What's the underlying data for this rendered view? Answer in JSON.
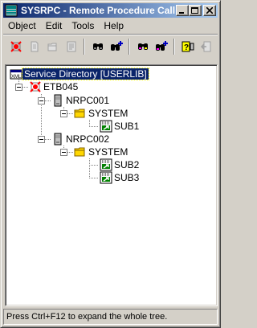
{
  "window": {
    "title": "SYSRPC - Remote Procedure Call"
  },
  "menu": {
    "items": [
      "Object",
      "Edit",
      "Tools",
      "Help"
    ]
  },
  "toolbar": {
    "buttons": [
      {
        "icon": "connect-icon"
      },
      {
        "icon": "new-document-icon"
      },
      {
        "icon": "folder-icon"
      },
      {
        "icon": "properties-icon"
      },
      {
        "icon": "find-icon"
      },
      {
        "icon": "find-next-icon"
      },
      {
        "icon": "find-colored-icon"
      },
      {
        "icon": "find-colored-next-icon"
      },
      {
        "icon": "help-icon"
      },
      {
        "icon": "exit-icon"
      }
    ]
  },
  "tree": {
    "root": "Service Directory [USERLIB]",
    "host": "ETB045",
    "nodes": [
      {
        "name": "NRPC001",
        "library": "SYSTEM",
        "subprograms": [
          "SUB1"
        ]
      },
      {
        "name": "NRPC002",
        "library": "SYSTEM",
        "subprograms": [
          "SUB2",
          "SUB3"
        ]
      }
    ]
  },
  "status": {
    "text": "Press Ctrl+F12 to expand the whole tree."
  },
  "colors": {
    "title_start": "#0a246a",
    "title_end": "#a6caf0",
    "selection": "#0a246a",
    "face": "#d4d0c8"
  }
}
